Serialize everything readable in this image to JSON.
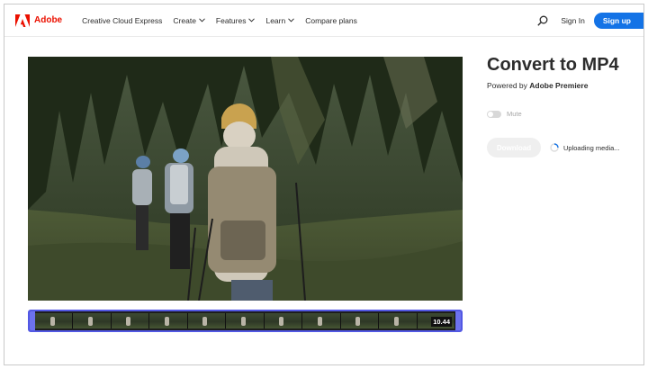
{
  "nav": {
    "brand": "Adobe",
    "items": [
      {
        "label": "Creative Cloud Express",
        "dropdown": false
      },
      {
        "label": "Create",
        "dropdown": true
      },
      {
        "label": "Features",
        "dropdown": true
      },
      {
        "label": "Learn",
        "dropdown": true
      },
      {
        "label": "Compare plans",
        "dropdown": false
      }
    ],
    "sign_in": "Sign In",
    "sign_up": "Sign up"
  },
  "timeline": {
    "duration": "10.44",
    "thumbnails": 11
  },
  "panel": {
    "title": "Convert to MP4",
    "powered_prefix": "Powered by ",
    "powered_brand": "Adobe Premiere",
    "mute_label": "Mute",
    "download_label": "Download",
    "status": "Uploading media..."
  },
  "colors": {
    "brand_red": "#eb1000",
    "accent_blue": "#1473e6",
    "timeline_border": "#5258e4"
  },
  "icons": {
    "logo": "adobe-logo-icon",
    "search": "search-icon",
    "chevron": "chevron-down-icon",
    "spinner": "spinner-icon"
  }
}
